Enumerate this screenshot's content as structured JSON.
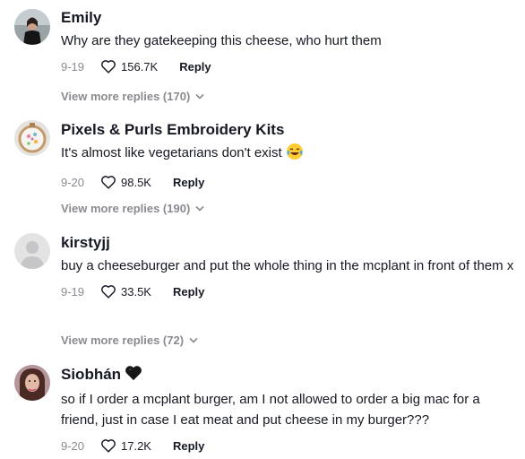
{
  "comments": [
    {
      "username": "Emily",
      "text": "Why are they gatekeeping this cheese, who hurt them",
      "date": "9-19",
      "likes": "156.7K",
      "reply_label": "Reply",
      "view_more": "View more replies (170)",
      "avatar_icon": "photo-avatar-dark"
    },
    {
      "username": "Pixels & Purls Embroidery Kits",
      "text": "It's almost like vegetarians don't exist",
      "emoji": "laughing-crying-emoji",
      "date": "9-20",
      "likes": "98.5K",
      "reply_label": "Reply",
      "view_more": "View more replies (190)",
      "avatar_icon": "embroidery-hoop-avatar"
    },
    {
      "username": "kirstyjj",
      "text": "buy a cheeseburger and put the whole thing in the mcplant in front of them x",
      "date": "9-19",
      "likes": "33.5K",
      "reply_label": "Reply",
      "view_more": "View more replies (72)",
      "avatar_icon": "default-user-avatar"
    },
    {
      "username": "Siobhán",
      "username_icon": "black-heart-emoji",
      "text": "so if I order a mcplant burger, am I not allowed to order a big mac for a friend, just in case I eat meat and put cheese in my burger???",
      "date": "9-20",
      "likes": "17.2K",
      "reply_label": "Reply",
      "avatar_icon": "photo-avatar-portrait"
    }
  ],
  "colors": {
    "text": "#161823",
    "muted": "#8a8b91"
  }
}
